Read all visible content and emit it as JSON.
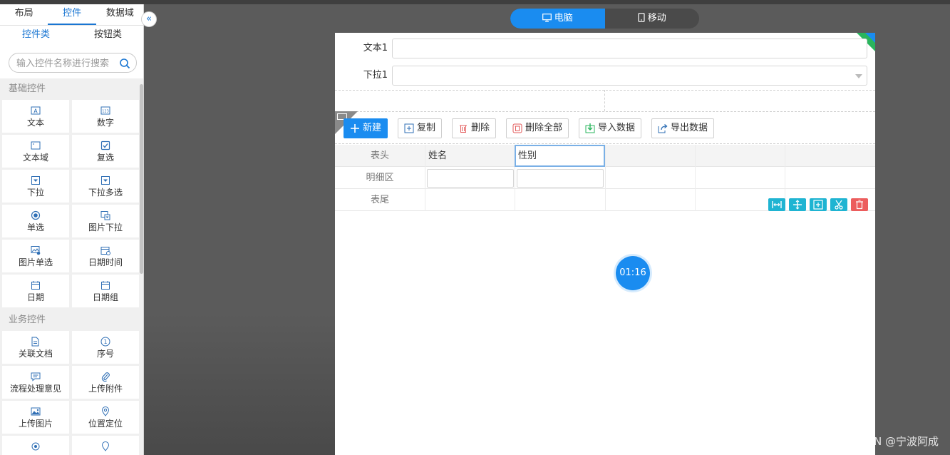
{
  "left_panel": {
    "tabs": [
      "布局",
      "控件",
      "数据域"
    ],
    "active_tab": "控件",
    "sub_tabs": [
      "控件类",
      "按钮类"
    ],
    "active_sub_tab": "控件类",
    "search_placeholder": "输入控件名称进行搜索",
    "sections": [
      {
        "title": "基础控件",
        "items": [
          {
            "label": "文本",
            "icon": "text-icon"
          },
          {
            "label": "数字",
            "icon": "number-icon"
          },
          {
            "label": "文本域",
            "icon": "textarea-icon"
          },
          {
            "label": "复选",
            "icon": "checkbox-icon"
          },
          {
            "label": "下拉",
            "icon": "dropdown-icon"
          },
          {
            "label": "下拉多选",
            "icon": "multi-dropdown-icon"
          },
          {
            "label": "单选",
            "icon": "radio-icon"
          },
          {
            "label": "图片下拉",
            "icon": "image-dropdown-icon"
          },
          {
            "label": "图片单选",
            "icon": "image-radio-icon"
          },
          {
            "label": "日期时间",
            "icon": "datetime-icon"
          },
          {
            "label": "日期",
            "icon": "calendar-icon"
          },
          {
            "label": "日期组",
            "icon": "date-group-icon"
          }
        ]
      },
      {
        "title": "业务控件",
        "items": [
          {
            "label": "关联文档",
            "icon": "linked-document-icon"
          },
          {
            "label": "序号",
            "icon": "serial-number-icon"
          },
          {
            "label": "流程处理意见",
            "icon": "comment-icon"
          },
          {
            "label": "上传附件",
            "icon": "paperclip-icon"
          },
          {
            "label": "上传图片",
            "icon": "image-upload-icon"
          },
          {
            "label": "位置定位",
            "icon": "location-pin-icon"
          }
        ]
      }
    ]
  },
  "device_toggle": {
    "options": [
      "电脑",
      "移动"
    ],
    "active": "电脑"
  },
  "form": {
    "fields": [
      {
        "label": "文本1",
        "type": "text",
        "value": ""
      },
      {
        "label": "下拉1",
        "type": "select",
        "value": ""
      }
    ]
  },
  "subtable": {
    "buttons": [
      {
        "label": "新建",
        "icon": "plus-icon"
      },
      {
        "label": "复制",
        "icon": "copy-icon"
      },
      {
        "label": "删除",
        "icon": "trash-icon"
      },
      {
        "label": "删除全部",
        "icon": "trash-all-icon"
      },
      {
        "label": "导入数据",
        "icon": "import-icon"
      },
      {
        "label": "导出数据",
        "icon": "export-icon"
      }
    ],
    "row_labels": [
      "表头",
      "明细区",
      "表尾"
    ],
    "headers": [
      "姓名",
      "性别",
      "",
      "",
      ""
    ],
    "tool_icons": [
      "resize-width-icon",
      "move-icon",
      "add-column-icon",
      "cut-icon",
      "delete-icon"
    ]
  },
  "timer": {
    "text": "01:16"
  },
  "watermark": "CSDN @宁波阿成"
}
